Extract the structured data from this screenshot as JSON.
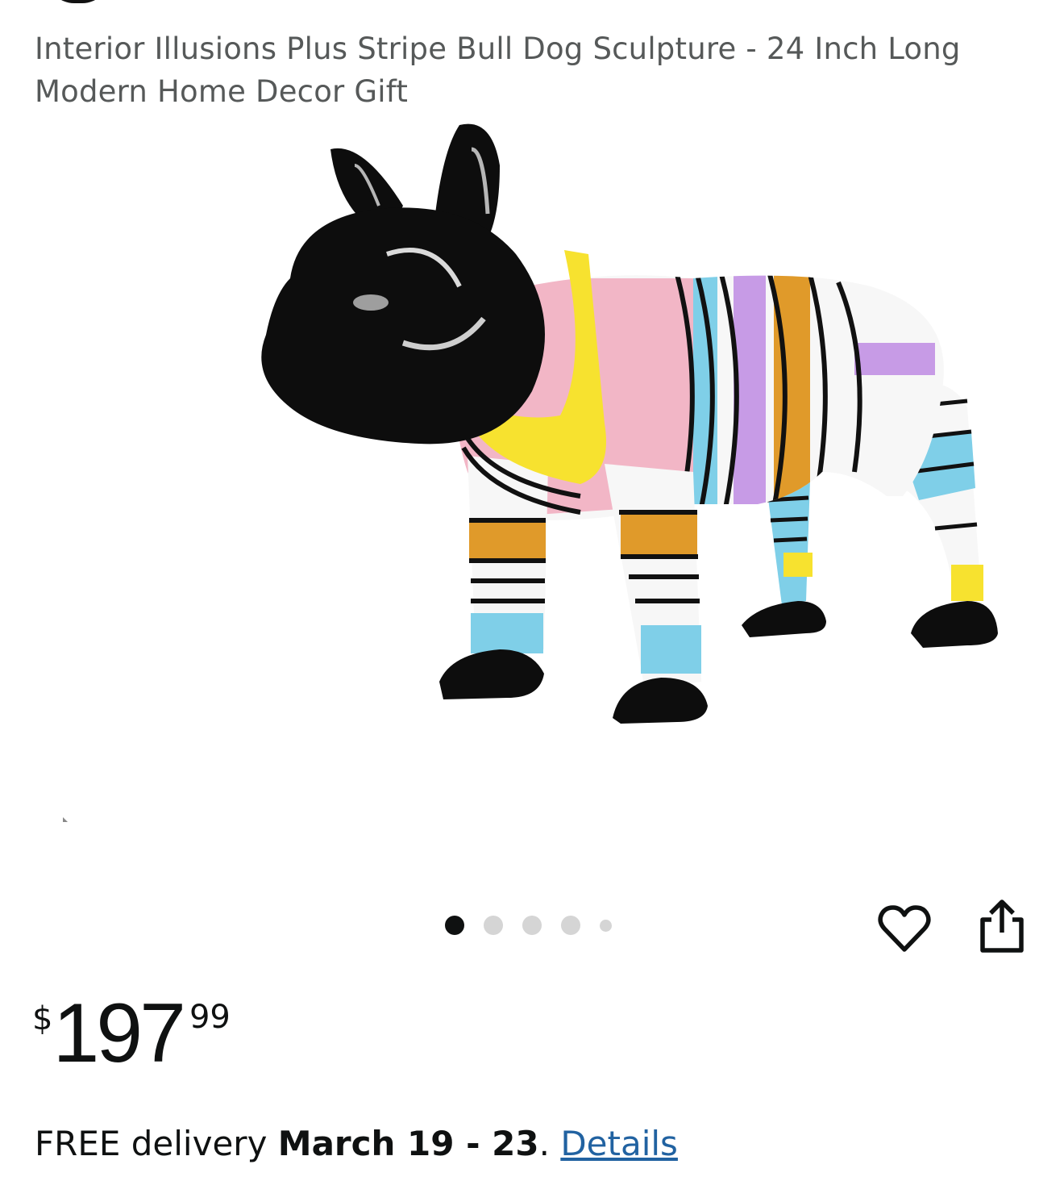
{
  "product": {
    "title": "Interior Illusions Plus Stripe Bull Dog Sculpture - 24 Inch Long Modern Home Decor Gift",
    "image": {
      "subject": "striped-bulldog-sculpture",
      "colors": {
        "black": "#0d0d0d",
        "pink": "#f2b6c6",
        "yellow": "#f7e22f",
        "blue": "#7fcfe8",
        "purple": "#c79be6",
        "orange": "#e09a2a",
        "white": "#f7f7f7"
      }
    },
    "carousel": {
      "count": 5,
      "active_index": 0
    }
  },
  "actions": {
    "favorite_icon": "heart-icon",
    "share_icon": "share-icon"
  },
  "price": {
    "currency": "$",
    "whole": "197",
    "fraction": "99"
  },
  "delivery": {
    "prefix": "FREE delivery ",
    "dates": "March 19 - 23",
    "separator": ". ",
    "details_link": "Details",
    "link_color": "#2162a1"
  }
}
